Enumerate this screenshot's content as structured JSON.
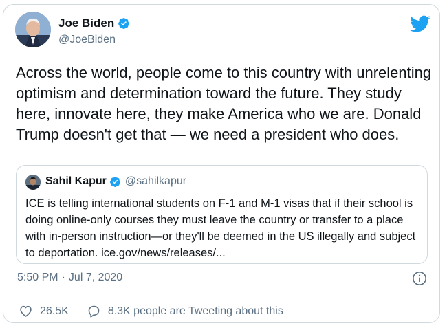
{
  "author": {
    "name": "Joe Biden",
    "handle": "@JoeBiden",
    "verified": true
  },
  "tweet": {
    "text": "Across the world, people come to this country with unrelenting optimism and determination toward the future. They study here, innovate here, they make America who we are. Donald Trump doesn't get that — we need a president who does."
  },
  "quoted": {
    "name": "Sahil Kapur",
    "handle": "@sahilkapur",
    "verified": true,
    "text": "ICE is telling international students on F-1 and M-1 visas that if their school is doing online-only courses they must leave the country or transfer to a place with in-person instruction—or they'll be deemed in the US illegally and subject to deportation. ice.gov/news/releases/..."
  },
  "meta": {
    "time": "5:50 PM",
    "date": "Jul 7, 2020"
  },
  "actions": {
    "likes": "26.5K",
    "tweeting": "8.3K people are Tweeting about this"
  },
  "icons": {
    "brand": "twitter-bird-icon",
    "verified": "verified-badge-icon",
    "like": "heart-icon",
    "reply": "speech-bubble-icon",
    "info": "info-icon"
  },
  "colors": {
    "brand": "#1da1f2",
    "text": "#0f1419",
    "secondary": "#5b7083",
    "border": "#cfd9de"
  }
}
